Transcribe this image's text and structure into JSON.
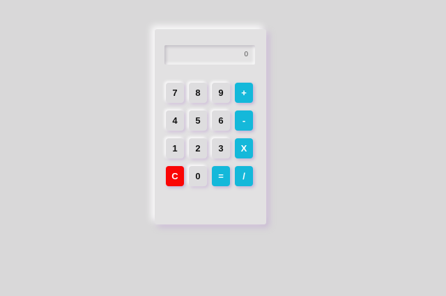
{
  "display": {
    "value": "0"
  },
  "keys": {
    "seven": "7",
    "eight": "8",
    "nine": "9",
    "plus": "+",
    "four": "4",
    "five": "5",
    "six": "6",
    "minus": "-",
    "one": "1",
    "two": "2",
    "three": "3",
    "multiply": "X",
    "clear": "C",
    "zero": "0",
    "equals": "=",
    "divide": "/"
  },
  "colors": {
    "background": "#d9d8d9",
    "operator": "#14b8da",
    "clear": "#fa0505",
    "number_key": "#dedddf"
  }
}
